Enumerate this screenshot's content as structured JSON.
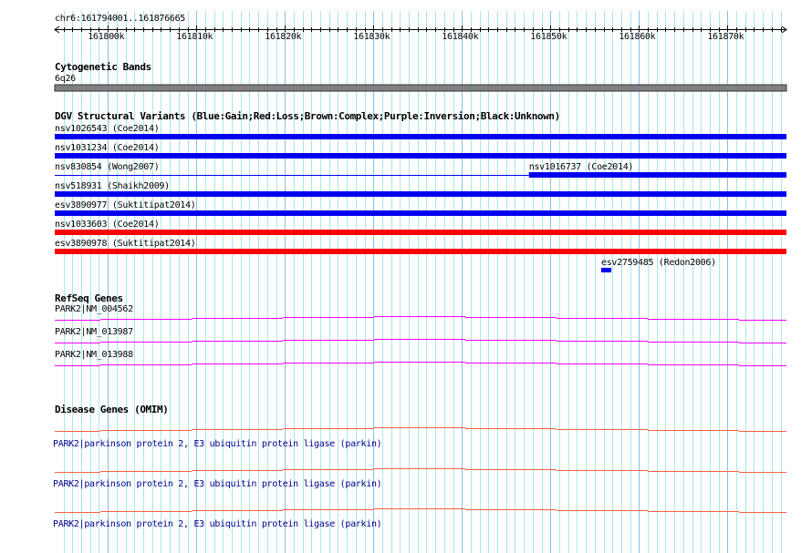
{
  "view": {
    "chrom_label": "chr6:161794001..161876665",
    "start": 161794001,
    "end": 161876665
  },
  "ruler": {
    "ticks": [
      {
        "pos": 161800000,
        "label": "161800k"
      },
      {
        "pos": 161810000,
        "label": "161810k"
      },
      {
        "pos": 161820000,
        "label": "161820k"
      },
      {
        "pos": 161830000,
        "label": "161830k"
      },
      {
        "pos": 161840000,
        "label": "161840k"
      },
      {
        "pos": 161850000,
        "label": "161850k"
      },
      {
        "pos": 161860000,
        "label": "161860k"
      },
      {
        "pos": 161870000,
        "label": "161870k"
      }
    ]
  },
  "cyto": {
    "title": "Cytogenetic Bands",
    "band": "6q26",
    "color": "#808080"
  },
  "dgv": {
    "title": "DGV Structural Variants (Blue:Gain;Red:Loss;Brown:Complex;Purple:Inversion;Black:Unknown)",
    "colors": {
      "gain": "#0000ee",
      "loss": "#ff0000"
    },
    "items": [
      {
        "label": "nsv1026543 (Coe2014)",
        "type": "gain",
        "row": 0,
        "start": 161794001,
        "end": 161876665
      },
      {
        "label": "nsv1031234 (Coe2014)",
        "type": "gain",
        "row": 1,
        "start": 161794001,
        "end": 161876665
      },
      {
        "label": "nsv830854 (Wong2007)",
        "type": "gain",
        "row": 2,
        "start": 161794001,
        "end": 161847570,
        "thin": true
      },
      {
        "label": "nsv1016737 (Coe2014)",
        "type": "gain",
        "row": 2,
        "start": 161847570,
        "end": 161876665
      },
      {
        "label": "nsv518931 (Shaikh2009)",
        "type": "gain",
        "row": 3,
        "start": 161794001,
        "end": 161876665
      },
      {
        "label": "esv3890977 (Suktitipat2014)",
        "type": "gain",
        "row": 4,
        "start": 161794001,
        "end": 161876665
      },
      {
        "label": "nsv1033603 (Coe2014)",
        "type": "loss",
        "row": 5,
        "start": 161794001,
        "end": 161876665
      },
      {
        "label": "esv3890978 (Suktitipat2014)",
        "type": "loss",
        "row": 6,
        "start": 161794001,
        "end": 161876665
      },
      {
        "label": "esv2759485 (Redon2006)",
        "type": "gain",
        "row": 7,
        "start": 161855740,
        "end": 161856880
      }
    ]
  },
  "refseq": {
    "title": "RefSeq Genes",
    "color": "#ff00ff",
    "genes": [
      {
        "label": "PARK2|NM_004562"
      },
      {
        "label": "PARK2|NM_013987"
      },
      {
        "label": "PARK2|NM_013988"
      }
    ]
  },
  "omim": {
    "title": "Disease Genes (OMIM)",
    "color": "#ff6040",
    "genes": [
      {
        "label": "PARK2|parkinson protein 2, E3 ubiquitin protein ligase (parkin)"
      },
      {
        "label": "PARK2|parkinson protein 2, E3 ubiquitin protein ligase (parkin)"
      },
      {
        "label": "PARK2|parkinson protein 2, E3 ubiquitin protein ligase (parkin)"
      }
    ]
  }
}
